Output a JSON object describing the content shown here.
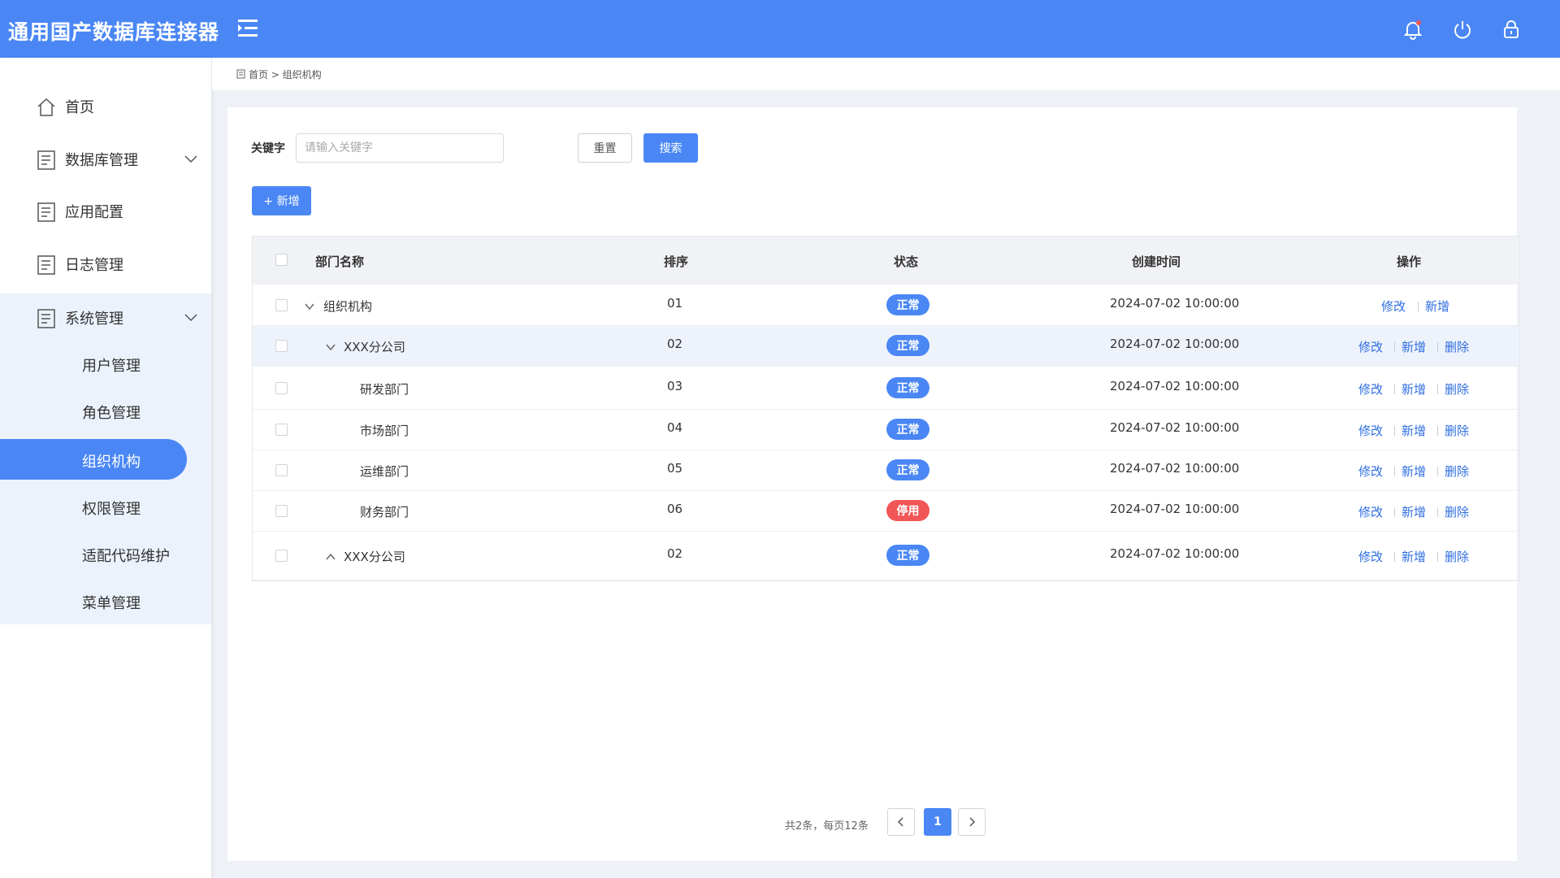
{
  "app": {
    "title": "通用国产数据库连接器"
  },
  "header": {
    "icons": [
      "menu-toggle-icon",
      "bell-icon",
      "power-icon",
      "lock-icon"
    ],
    "accent_color": "#4a87f5"
  },
  "sidebar": {
    "items": [
      {
        "label": "首页",
        "icon": "home-icon"
      },
      {
        "label": "数据库管理",
        "icon": "document-icon",
        "expandable": true
      },
      {
        "label": "应用配置",
        "icon": "document-icon"
      },
      {
        "label": "日志管理",
        "icon": "document-icon"
      },
      {
        "label": "系统管理",
        "icon": "document-icon",
        "expandable": true
      }
    ],
    "submenu": [
      {
        "label": "用户管理"
      },
      {
        "label": "角色管理"
      },
      {
        "label": "组织机构",
        "active": true
      },
      {
        "label": "权限管理"
      },
      {
        "label": "适配代码维护"
      },
      {
        "label": "菜单管理"
      }
    ]
  },
  "breadcrumb": {
    "text": "首页 > 组织机构"
  },
  "filter": {
    "keyword_label": "关键字",
    "keyword_value": "",
    "keyword_placeholder": "请输入关键字",
    "reset_label": "重置",
    "search_label": "搜索",
    "add_label": "+ 新增"
  },
  "table": {
    "columns": [
      "部门名称",
      "排序",
      "状态",
      "创建时间",
      "操作"
    ],
    "rows": [
      {
        "name": "组织机构",
        "sort": "01",
        "status": "正常",
        "status_type": "ok",
        "created": "2024-07-02 10:00:00",
        "actions": [
          "修改",
          "新增"
        ],
        "caret": "down",
        "level": 0
      },
      {
        "name": "XXX分公司",
        "sort": "02",
        "status": "正常",
        "status_type": "ok",
        "created": "2024-07-02 10:00:00",
        "actions": [
          "修改",
          "新增",
          "删除"
        ],
        "caret": "down",
        "level": 1
      },
      {
        "name": "研发部门",
        "sort": "03",
        "status": "正常",
        "status_type": "ok",
        "created": "2024-07-02 10:00:00",
        "actions": [
          "修改",
          "新增",
          "删除"
        ],
        "caret": "none",
        "level": 2
      },
      {
        "name": "市场部门",
        "sort": "04",
        "status": "正常",
        "status_type": "ok",
        "created": "2024-07-02 10:00:00",
        "actions": [
          "修改",
          "新增",
          "删除"
        ],
        "caret": "none",
        "level": 2
      },
      {
        "name": "运维部门",
        "sort": "05",
        "status": "正常",
        "status_type": "ok",
        "created": "2024-07-02 10:00:00",
        "actions": [
          "修改",
          "新增",
          "删除"
        ],
        "caret": "none",
        "level": 2
      },
      {
        "name": "财务部门",
        "sort": "06",
        "status": "停用",
        "status_type": "off",
        "created": "2024-07-02 10:00:00",
        "actions": [
          "修改",
          "新增",
          "删除"
        ],
        "caret": "none",
        "level": 2
      },
      {
        "name": "XXX分公司",
        "sort": "02",
        "status": "正常",
        "status_type": "ok",
        "created": "2024-07-02 10:00:00",
        "actions": [
          "修改",
          "新增",
          "删除"
        ],
        "caret": "up",
        "level": 1
      }
    ]
  },
  "pagination": {
    "summary": "共2条，每页12条",
    "current_page": "1"
  },
  "colors": {
    "ok": "#4a87f5",
    "off": "#f25656",
    "link": "#2f6ee0"
  }
}
